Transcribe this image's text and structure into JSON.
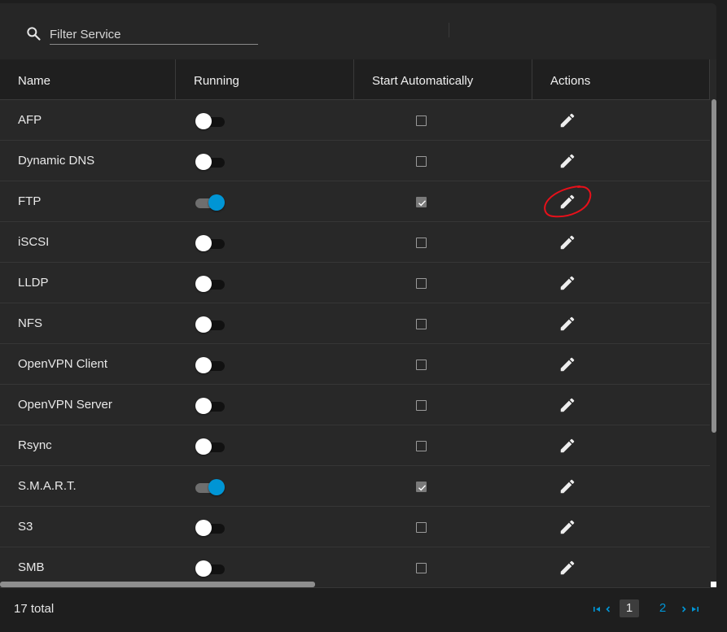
{
  "toolbar": {
    "search_placeholder": "Filter Service"
  },
  "table": {
    "columns": [
      "Name",
      "Running",
      "Start Automatically",
      "Actions"
    ],
    "rows": [
      {
        "name": "AFP",
        "running": false,
        "start_automatically": false
      },
      {
        "name": "Dynamic DNS",
        "running": false,
        "start_automatically": false
      },
      {
        "name": "FTP",
        "running": true,
        "start_automatically": true
      },
      {
        "name": "iSCSI",
        "running": false,
        "start_automatically": false
      },
      {
        "name": "LLDP",
        "running": false,
        "start_automatically": false
      },
      {
        "name": "NFS",
        "running": false,
        "start_automatically": false
      },
      {
        "name": "OpenVPN Client",
        "running": false,
        "start_automatically": false
      },
      {
        "name": "OpenVPN Server",
        "running": false,
        "start_automatically": false
      },
      {
        "name": "Rsync",
        "running": false,
        "start_automatically": false
      },
      {
        "name": "S.M.A.R.T.",
        "running": true,
        "start_automatically": true
      },
      {
        "name": "S3",
        "running": false,
        "start_automatically": false
      },
      {
        "name": "SMB",
        "running": false,
        "start_automatically": false
      }
    ]
  },
  "footer": {
    "total": "17 total",
    "pages": [
      "1",
      "2"
    ],
    "current_page": "1"
  },
  "colors": {
    "accent": "#0095d5",
    "annotation": "#e8101a",
    "background": "#282828"
  },
  "icons": {
    "search": "search-icon",
    "edit": "pencil-icon",
    "first_page": "first-page-icon",
    "prev_page": "chevron-left-icon",
    "next_page": "chevron-right-icon",
    "last_page": "last-page-icon"
  }
}
